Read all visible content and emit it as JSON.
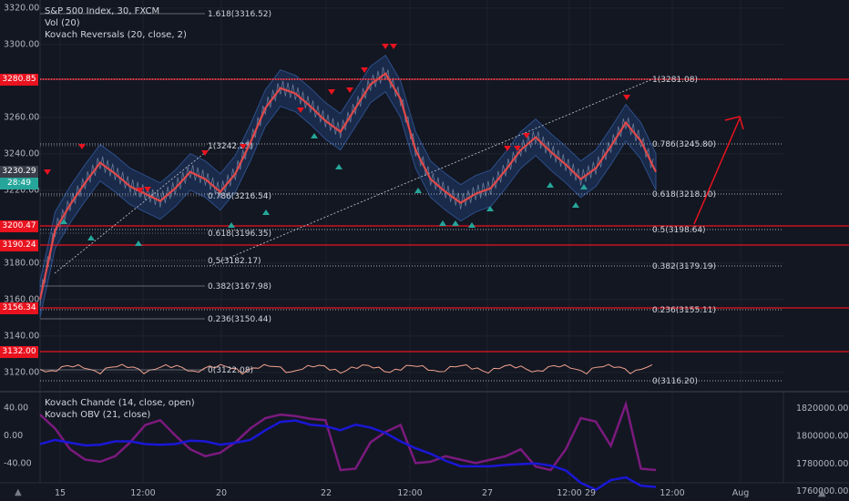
{
  "header": {
    "symbol": "S&P 500 Index, 30, FXCM",
    "volume": "Vol (20)",
    "indicator": "Kovach Reversals (20, close, 2)"
  },
  "lower_legend": {
    "line1": "Kovach Chande (14, close, open)",
    "line2": "Kovach OBV (21, close)"
  },
  "price_tags": {
    "last": "3230.29",
    "timer": "28:49",
    "levels": [
      "3280.85",
      "3200.47",
      "3190.24",
      "3156.34",
      "3132.00"
    ]
  },
  "footer_icon": "tradingview-logo",
  "colors": {
    "background": "#131722",
    "ma": "#e0494b",
    "band": "#1f3b6b",
    "hline": "#e8131f",
    "arrow_down": "#e8131f",
    "arrow_up": "#26a69a",
    "obv": "#1a17d6",
    "kc": "#7b1a7e",
    "volume_osc": "#f2a38e"
  },
  "chart_data": [
    {
      "type": "line",
      "title": "S&P 500 Index, 30, FXCM",
      "y_axis_labels": [
        "3320.00",
        "3300.00",
        "3260.00",
        "3240.00",
        "3220.00",
        "3180.00",
        "3160.00",
        "3140.00",
        "3120.00"
      ],
      "x_axis_labels": [
        "15",
        "12:00",
        "20",
        "22",
        "12:00",
        "27",
        "12:00",
        "29",
        "12:00",
        "Aug"
      ],
      "ylim": [
        3112,
        3324
      ],
      "x": [
        0,
        4,
        8,
        12,
        16,
        20,
        24,
        28,
        32,
        36,
        40,
        44,
        48,
        52,
        56,
        60,
        64,
        68,
        72,
        76,
        80,
        84,
        88,
        92,
        96,
        100,
        104,
        108,
        112,
        116,
        120,
        124,
        128,
        132,
        136,
        140,
        144,
        148,
        152,
        156,
        160,
        164
      ],
      "series": [
        {
          "values": [
            3160,
            3198,
            3212,
            3224,
            3235,
            3229,
            3222,
            3218,
            3214,
            3221,
            3230,
            3226,
            3219,
            3229,
            3246,
            3265,
            3276,
            3273,
            3266,
            3258,
            3252,
            3265,
            3278,
            3284,
            3270,
            3242,
            3226,
            3219,
            3213,
            3218,
            3221,
            3231,
            3242,
            3249,
            3241,
            3234,
            3226,
            3232,
            3244,
            3257,
            3247,
            3230
          ]
        }
      ],
      "fib_labels": [
        "1.618(3316.52)",
        "1(3242.25)",
        "0.786(3216.54)",
        "0.618(3196.35)",
        "0.5(3182.17)",
        "0.382(3167.98)",
        "0.236(3150.44)",
        "0(3122.08)",
        "1(3281.08)",
        "0.786(3245.80)",
        "0.618(3218.10)",
        "0.5(3198.64)",
        "0.382(3179.19)",
        "0.236(3155.11)",
        "0(3116.20)"
      ],
      "horizontal_lines": [
        3280.85,
        3200.47,
        3190.24,
        3156.34,
        3132.0
      ]
    },
    {
      "type": "line",
      "y_axis_labels": [
        "40.00",
        "0.00",
        "-40.00"
      ],
      "right_axis_labels": [
        "1820000.00",
        "1800000.00",
        "1780000.00",
        "1760000.00"
      ],
      "ylim": [
        -60,
        60
      ],
      "x": [
        0,
        4,
        8,
        12,
        16,
        20,
        24,
        28,
        32,
        36,
        40,
        44,
        48,
        52,
        56,
        60,
        64,
        68,
        72,
        76,
        80,
        84,
        88,
        92,
        96,
        100,
        104,
        108,
        112,
        116,
        120,
        124,
        128,
        132,
        136,
        140,
        144,
        148,
        152,
        156,
        160,
        164
      ],
      "series": [
        {
          "name": "Kovach Chande (14, close, open)",
          "values": [
            30,
            10,
            -20,
            -35,
            -38,
            -30,
            -10,
            15,
            22,
            0,
            -20,
            -30,
            -25,
            -10,
            10,
            25,
            30,
            28,
            24,
            22,
            -50,
            -48,
            -10,
            5,
            15,
            -40,
            -38,
            -30,
            -35,
            -40,
            -35,
            -30,
            -20,
            -45,
            -50,
            -20,
            25,
            20,
            -15,
            45,
            -48,
            -50
          ]
        },
        {
          "name": "Kovach OBV (21, close)",
          "values": [
            1794000,
            1797000,
            1795000,
            1793000,
            1793500,
            1796000,
            1796000,
            1794000,
            1793500,
            1794000,
            1796500,
            1796000,
            1793500,
            1795000,
            1797000,
            1804000,
            1810000,
            1811000,
            1808000,
            1807000,
            1804000,
            1808000,
            1806000,
            1802000,
            1796000,
            1791000,
            1787000,
            1782000,
            1778000,
            1778000,
            1778000,
            1779000,
            1779500,
            1780000,
            1778500,
            1775000,
            1766000,
            1761000,
            1768000,
            1770000,
            1764000,
            1763000
          ]
        }
      ]
    }
  ]
}
